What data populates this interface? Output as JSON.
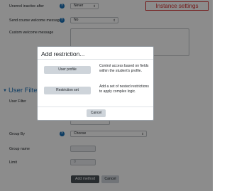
{
  "form": {
    "unenrol_inactive": {
      "label": "Unenrol inactive after",
      "value": "Never"
    },
    "send_welcome": {
      "label": "Send course welcome message",
      "value": "No"
    },
    "custom_welcome": {
      "label": "Custom welcome message"
    },
    "section_title": "User Filter",
    "user_filter": {
      "label": "User Filter"
    },
    "group_by": {
      "label": "Group By",
      "value": "Choose"
    },
    "group_name": {
      "label": "Group name"
    },
    "limit": {
      "label": "Limit",
      "value": "0"
    },
    "add_method_label": "Add method",
    "cancel_label": "Cancel"
  },
  "annotation": {
    "label": "Instance settings",
    "color": "#d32f2f"
  },
  "modal": {
    "title": "Add restriction...",
    "options": [
      {
        "button": "User profile",
        "description": "Control access based on fields within the student's profile."
      },
      {
        "button": "Restriction set",
        "description": "Add a set of nested restrictions to apply complex logic."
      }
    ],
    "cancel_label": "Cancel"
  },
  "icons": {
    "help": "question-circle-icon",
    "dropdown": "chevron-down-icon",
    "section": "caret-down-icon"
  },
  "colors": {
    "accent": "#1b6fb5",
    "primary_button": "#495057",
    "secondary_button": "#ced4da"
  }
}
